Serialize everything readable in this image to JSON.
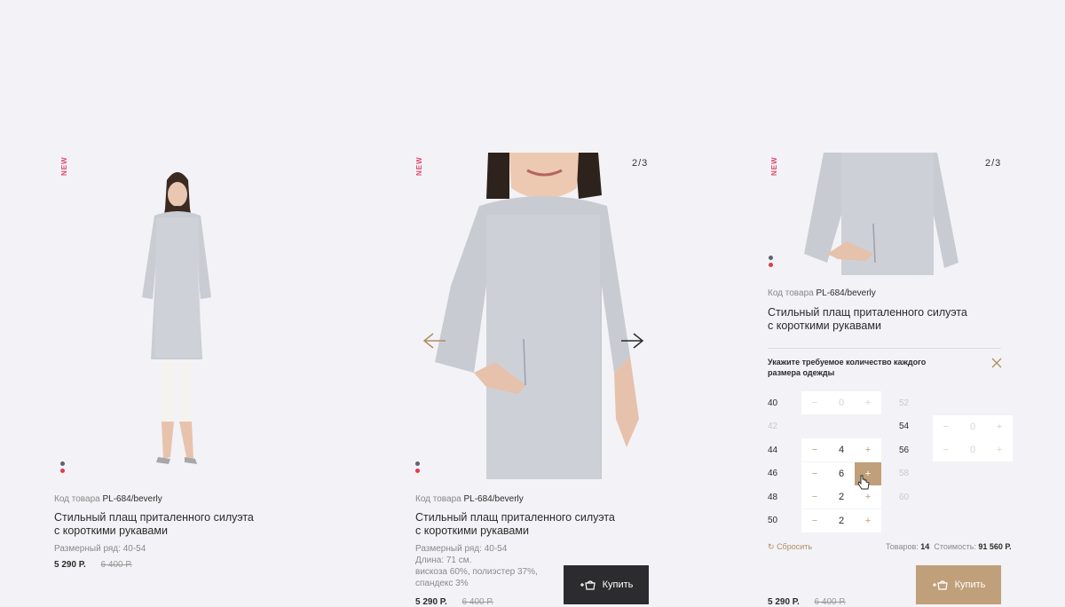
{
  "badge_new": "NEW",
  "colors": {
    "accent": "#bfa07a",
    "badge": "#e2456a",
    "dark_button": "#2c2c2e",
    "dot_gray": "#5c6472",
    "dot_red": "#e23b4a"
  },
  "card1": {
    "code_label": "Код товара",
    "code_value": "PL-684/beverly",
    "title_line1": "Стильный плащ приталенного силуэта",
    "title_line2": "с короткими рукавами",
    "size_range": "Размерный ряд: 40-54",
    "price": "5 290 Р.",
    "old_price": "6 400 Р."
  },
  "card2": {
    "counter": "2/3",
    "code_label": "Код товара",
    "code_value": "PL-684/beverly",
    "title_line1": "Стильный плащ приталенного силуэта",
    "title_line2": "с короткими рукавами",
    "size_range": "Размерный ряд: 40-54",
    "length": "Длина: 71 см.",
    "composition1": "вискоза 60%, полиэстер 37%,",
    "composition2": "спандекс 3%",
    "price": "5 290 Р.",
    "old_price": "6 400 Р.",
    "buy_label": "Купить"
  },
  "card3": {
    "counter": "2/3",
    "code_label": "Код товара",
    "code_value": "PL-684/beverly",
    "title_line1": "Стильный плащ приталенного силуэта",
    "title_line2": "с короткими рукавами",
    "hint_line1": "Укажите требуемое количество каждого",
    "hint_line2": "размера одежды",
    "sizes_left": [
      {
        "size": "40",
        "value": "0",
        "enabled": true,
        "zero": true
      },
      {
        "size": "42",
        "value": "",
        "enabled": false
      },
      {
        "size": "44",
        "value": "4",
        "enabled": true
      },
      {
        "size": "46",
        "value": "6",
        "enabled": true
      },
      {
        "size": "48",
        "value": "2",
        "enabled": true
      },
      {
        "size": "50",
        "value": "2",
        "enabled": true
      }
    ],
    "sizes_right": [
      {
        "size": "52",
        "value": "",
        "enabled": false
      },
      {
        "size": "54",
        "value": "0",
        "enabled": true,
        "zero": true
      },
      {
        "size": "56",
        "value": "0",
        "enabled": true,
        "zero": true
      },
      {
        "size": "58",
        "value": "",
        "enabled": false
      },
      {
        "size": "60",
        "value": "",
        "enabled": false
      }
    ],
    "minus": "−",
    "plus": "+",
    "reset_label": "Сбросить",
    "items_label": "Товаров:",
    "items_value": "14",
    "cost_label": "Стоимость:",
    "cost_value": "91 560 Р.",
    "price": "5 290 Р.",
    "old_price": "6 400 Р.",
    "buy_label": "Купить"
  }
}
